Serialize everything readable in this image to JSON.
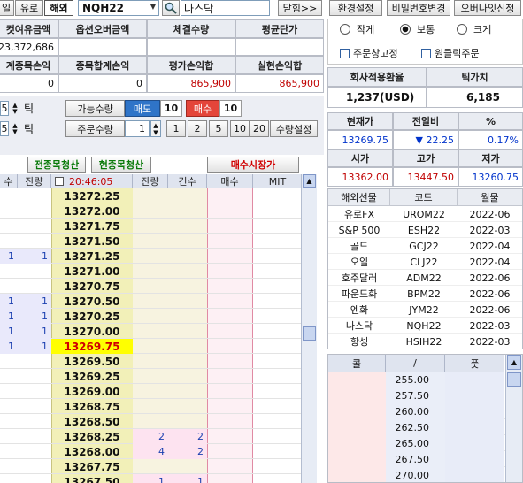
{
  "top": {
    "tab_left": "일",
    "tab_euro": "유로",
    "tab_overseas": "해외",
    "symbol_code": "NQH22",
    "symbol_name": "나스닥",
    "dock_button": "닫힘>>"
  },
  "account_summary": {
    "headers_row1": [
      "컷여유금액",
      "옵션오버금액",
      "체결수량",
      "평균단가"
    ],
    "values_row1": [
      "23,372,686",
      "",
      "",
      ""
    ],
    "headers_row2": [
      "계종목손익",
      "종목합계손익",
      "평가손익합",
      "실현손익합"
    ],
    "values_row2": [
      "0",
      "0",
      "865,900",
      "865,900"
    ]
  },
  "order_controls": {
    "tick_label": "틱",
    "tick_values": [
      "5",
      "5"
    ],
    "available_qty_label": "가능수량",
    "sell_label": "매도",
    "sell_qty": "10",
    "buy_label": "매수",
    "buy_qty": "10",
    "order_qty_label": "주문수량",
    "order_qty_value": "1",
    "qty_presets": [
      "1",
      "2",
      "5",
      "10",
      "20"
    ],
    "qty_settings": "수량설정",
    "liquidate_all": "전종목청산",
    "liquidate_current": "현종목청산",
    "market_buy": "매수시장가"
  },
  "ladder": {
    "headers": [
      "수",
      "잔량",
      "20:46:05",
      "잔량",
      "건수",
      "매수",
      "MIT"
    ],
    "current_price": "13269.75",
    "rows": [
      {
        "ask_cnt": "",
        "ask_qty": "",
        "price": "13272.25",
        "bid_qty": "",
        "bid_cnt": ""
      },
      {
        "ask_cnt": "",
        "ask_qty": "",
        "price": "13272.00",
        "bid_qty": "",
        "bid_cnt": ""
      },
      {
        "ask_cnt": "",
        "ask_qty": "",
        "price": "13271.75",
        "bid_qty": "",
        "bid_cnt": ""
      },
      {
        "ask_cnt": "",
        "ask_qty": "",
        "price": "13271.50",
        "bid_qty": "",
        "bid_cnt": ""
      },
      {
        "ask_cnt": "1",
        "ask_qty": "1",
        "price": "13271.25",
        "bid_qty": "",
        "bid_cnt": ""
      },
      {
        "ask_cnt": "",
        "ask_qty": "",
        "price": "13271.00",
        "bid_qty": "",
        "bid_cnt": ""
      },
      {
        "ask_cnt": "",
        "ask_qty": "",
        "price": "13270.75",
        "bid_qty": "",
        "bid_cnt": ""
      },
      {
        "ask_cnt": "1",
        "ask_qty": "1",
        "price": "13270.50",
        "bid_qty": "",
        "bid_cnt": ""
      },
      {
        "ask_cnt": "1",
        "ask_qty": "1",
        "price": "13270.25",
        "bid_qty": "",
        "bid_cnt": ""
      },
      {
        "ask_cnt": "1",
        "ask_qty": "1",
        "price": "13270.00",
        "bid_qty": "",
        "bid_cnt": ""
      },
      {
        "ask_cnt": "1",
        "ask_qty": "1",
        "price": "13269.75",
        "bid_qty": "",
        "bid_cnt": ""
      },
      {
        "ask_cnt": "",
        "ask_qty": "",
        "price": "13269.50",
        "bid_qty": "",
        "bid_cnt": ""
      },
      {
        "ask_cnt": "",
        "ask_qty": "",
        "price": "13269.25",
        "bid_qty": "",
        "bid_cnt": ""
      },
      {
        "ask_cnt": "",
        "ask_qty": "",
        "price": "13269.00",
        "bid_qty": "",
        "bid_cnt": ""
      },
      {
        "ask_cnt": "",
        "ask_qty": "",
        "price": "13268.75",
        "bid_qty": "",
        "bid_cnt": ""
      },
      {
        "ask_cnt": "",
        "ask_qty": "",
        "price": "13268.50",
        "bid_qty": "",
        "bid_cnt": ""
      },
      {
        "ask_cnt": "",
        "ask_qty": "",
        "price": "13268.25",
        "bid_qty": "2",
        "bid_cnt": "2"
      },
      {
        "ask_cnt": "",
        "ask_qty": "",
        "price": "13268.00",
        "bid_qty": "4",
        "bid_cnt": "2"
      },
      {
        "ask_cnt": "",
        "ask_qty": "",
        "price": "13267.75",
        "bid_qty": "",
        "bid_cnt": ""
      },
      {
        "ask_cnt": "",
        "ask_qty": "",
        "price": "13267.50",
        "bid_qty": "1",
        "bid_cnt": "1"
      }
    ]
  },
  "right_panel": {
    "env_settings": "환경설정",
    "password_change": "비밀번호변경",
    "overnight_apply": "오버나잇신청",
    "radio_options": [
      "작게",
      "보통",
      "크게"
    ],
    "radio_selected": "보통",
    "check_fixed_order": "주문창고정",
    "check_one_click": "원클릭주문",
    "fx_rate_label": "회사적용환율",
    "tick_value_label": "틱가치",
    "fx_rate_value": "1,237(USD)",
    "tick_value_value": "6,185",
    "quote": {
      "current_label": "현재가",
      "prev_label": "전일비",
      "pct_label": "%",
      "current": "13269.75",
      "prev": "▼ 22.25",
      "pct": "0.17%",
      "open_label": "시가",
      "high_label": "고가",
      "low_label": "저가",
      "open": "13362.00",
      "high": "13447.50",
      "low": "13260.75"
    },
    "futures_headers": [
      "해외선물",
      "코드",
      "월물"
    ],
    "futures": [
      {
        "name": "유로FX",
        "code": "UROM22",
        "month": "2022-06"
      },
      {
        "name": "S&P 500",
        "code": "ESH22",
        "month": "2022-03"
      },
      {
        "name": "골드",
        "code": "GCJ22",
        "month": "2022-04"
      },
      {
        "name": "오일",
        "code": "CLJ22",
        "month": "2022-04"
      },
      {
        "name": "호주달러",
        "code": "ADM22",
        "month": "2022-06"
      },
      {
        "name": "파운드화",
        "code": "BPM22",
        "month": "2022-06"
      },
      {
        "name": "엔화",
        "code": "JYM22",
        "month": "2022-06"
      },
      {
        "name": "나스닥",
        "code": "NQH22",
        "month": "2022-03"
      },
      {
        "name": "항셍",
        "code": "HSIH22",
        "month": "2022-03"
      }
    ],
    "options_headers": [
      "콜",
      "/",
      "풋"
    ],
    "strikes": [
      "255.00",
      "257.50",
      "260.00",
      "262.50",
      "265.00",
      "267.50",
      "270.00"
    ]
  }
}
